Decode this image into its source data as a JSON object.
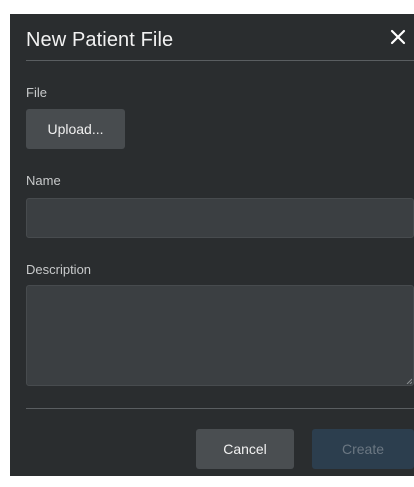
{
  "dialog": {
    "title": "New Patient File",
    "close_icon": "close-icon"
  },
  "form": {
    "file_label": "File",
    "upload_label": "Upload...",
    "name_label": "Name",
    "name_value": "",
    "description_label": "Description",
    "description_value": ""
  },
  "footer": {
    "cancel_label": "Cancel",
    "create_label": "Create",
    "create_enabled": false
  },
  "colors": {
    "dialog_bg": "#2a2d2f",
    "input_bg": "#3b3f42",
    "button_bg": "#4a4e51",
    "primary_disabled_bg": "#2c3e4e",
    "primary_disabled_text": "#6b7782"
  }
}
